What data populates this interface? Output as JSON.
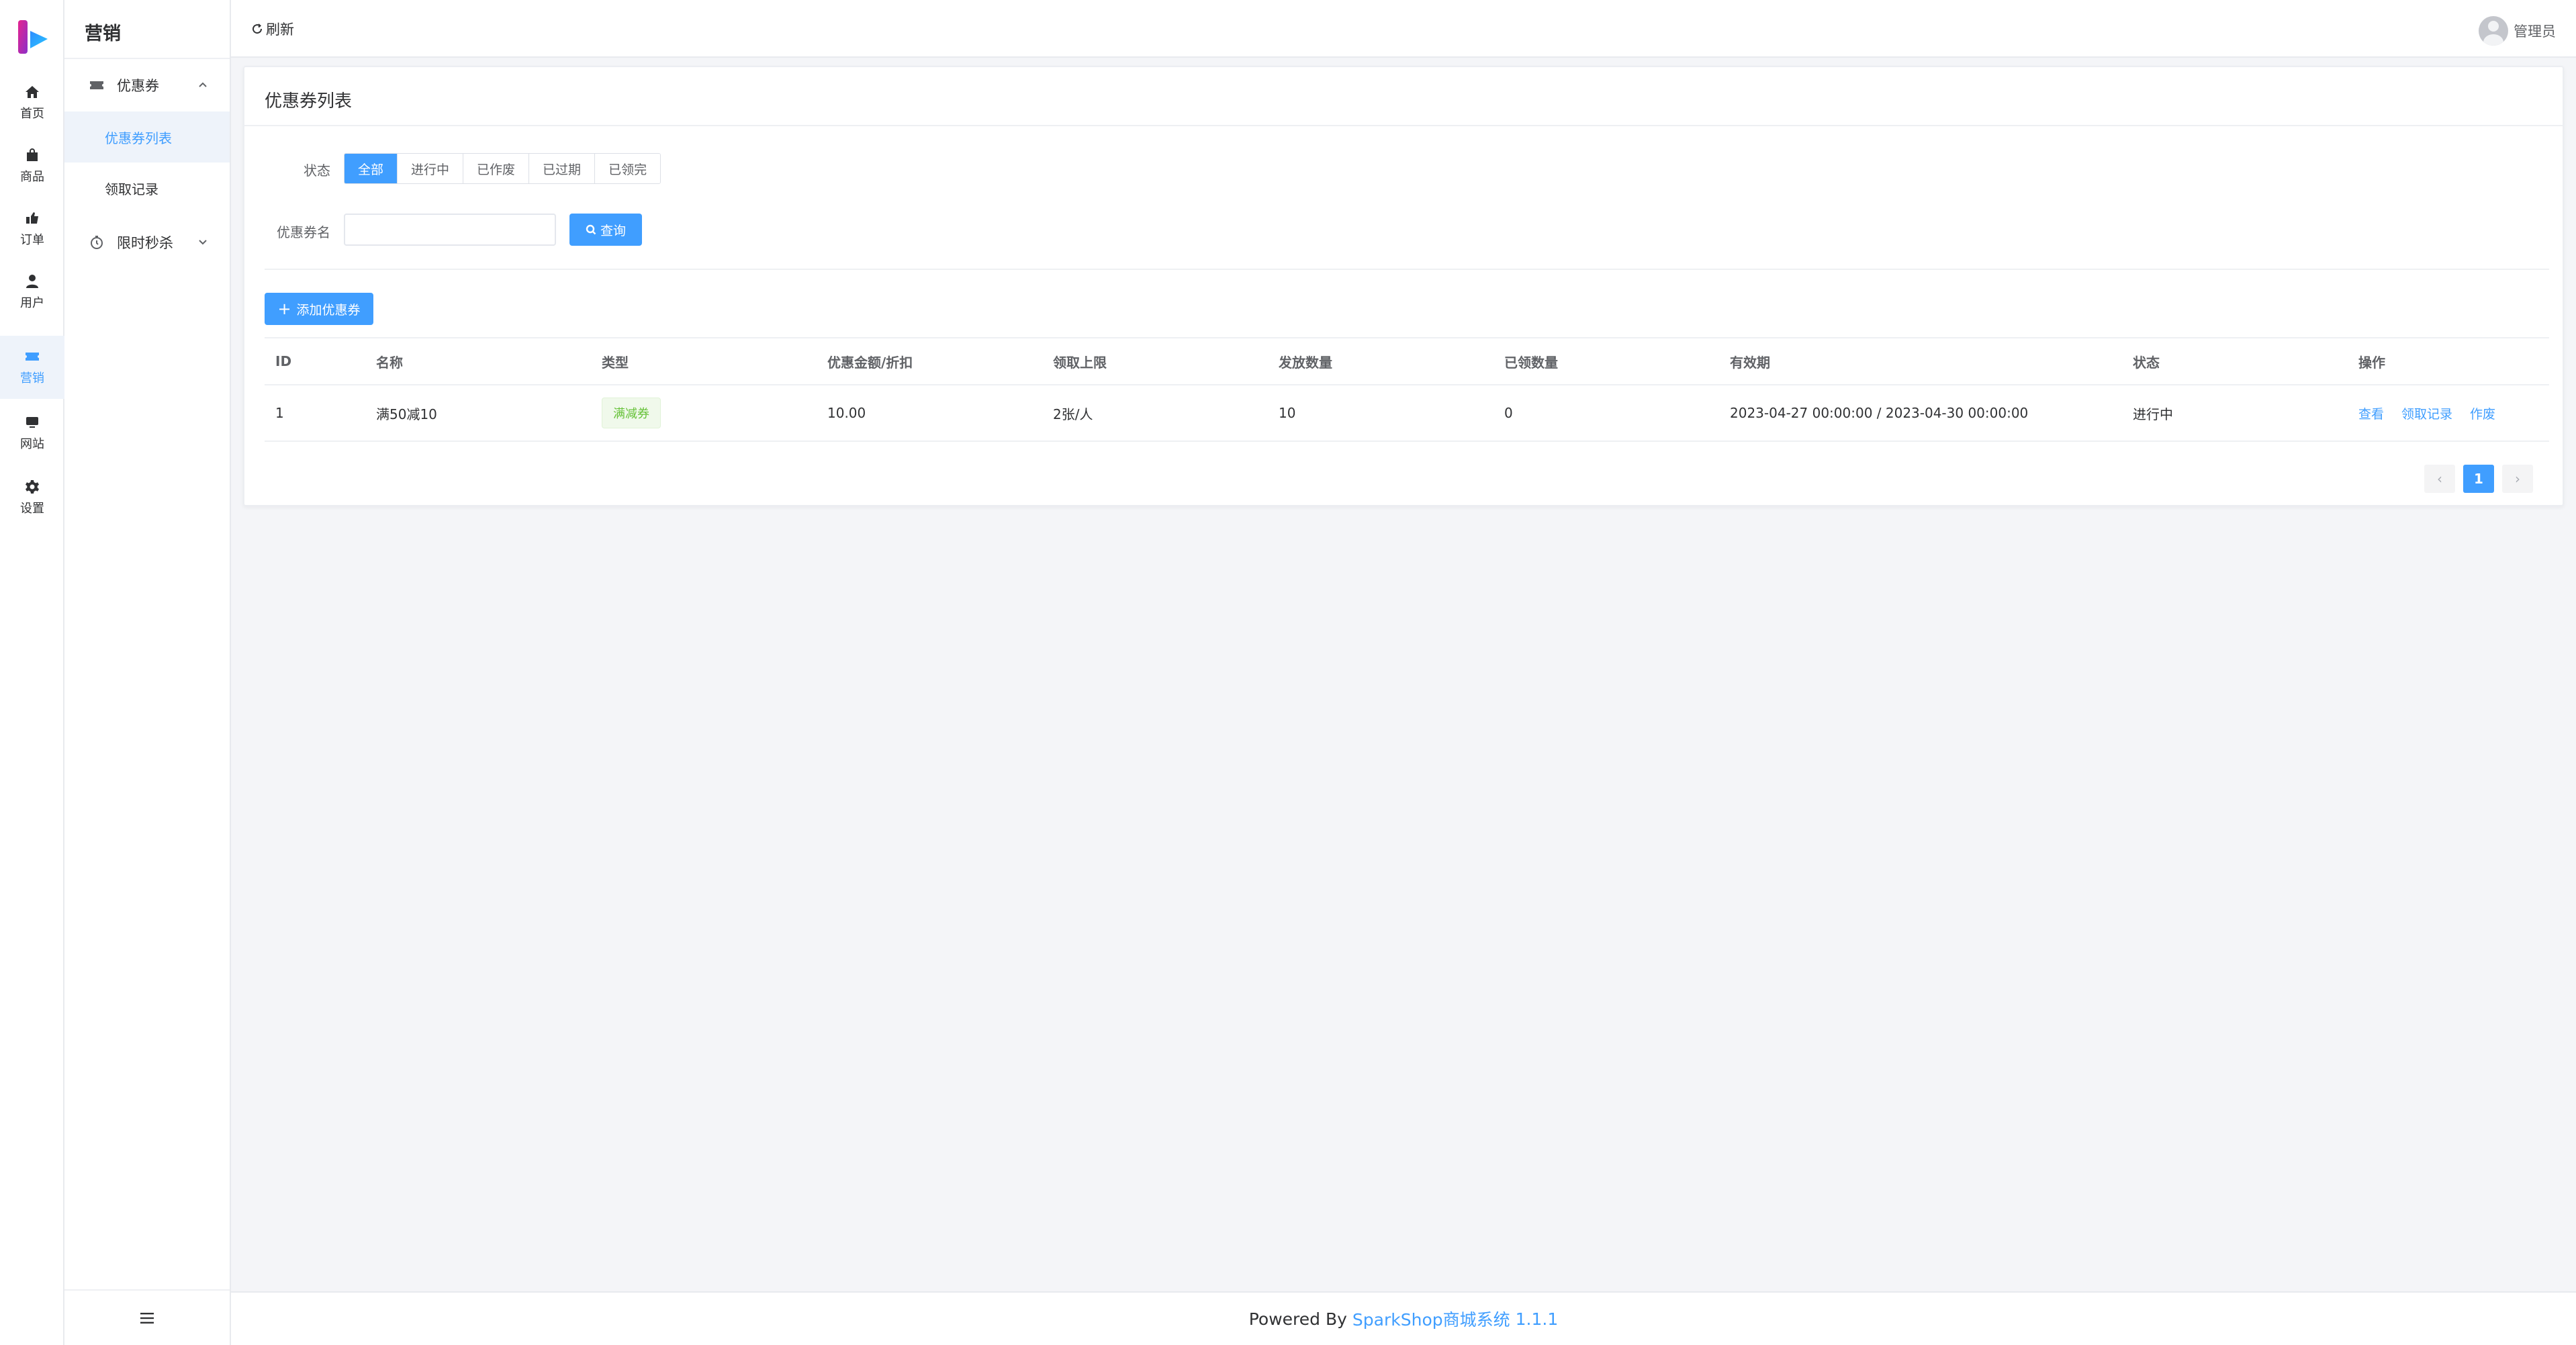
{
  "rail": {
    "items": [
      {
        "label": "首页",
        "icon": "home-icon"
      },
      {
        "label": "商品",
        "icon": "bag-icon"
      },
      {
        "label": "订单",
        "icon": "order-icon"
      },
      {
        "label": "用户",
        "icon": "user-icon"
      },
      {
        "label": "营销",
        "icon": "ticket-icon",
        "active": true
      },
      {
        "label": "网站",
        "icon": "monitor-icon"
      },
      {
        "label": "设置",
        "icon": "gear-icon"
      }
    ]
  },
  "sidebar": {
    "title": "营销",
    "groups": [
      {
        "label": "优惠券",
        "icon": "ticket-icon",
        "expanded": true,
        "children": [
          {
            "label": "优惠券列表",
            "active": true
          },
          {
            "label": "领取记录"
          }
        ]
      },
      {
        "label": "限时秒杀",
        "icon": "stopwatch-icon",
        "expanded": false
      }
    ]
  },
  "topbar": {
    "refresh_label": "刷新",
    "user_name": "管理员"
  },
  "card": {
    "title": "优惠券列表",
    "filter": {
      "status_label": "状态",
      "status_options": [
        "全部",
        "进行中",
        "已作废",
        "已过期",
        "已领完"
      ],
      "selected_status": "全部",
      "name_label": "优惠券名",
      "name_value": "",
      "query_label": "查询"
    },
    "add_label": "添加优惠券",
    "table": {
      "columns": [
        "ID",
        "名称",
        "类型",
        "优惠金额/折扣",
        "领取上限",
        "发放数量",
        "已领数量",
        "有效期",
        "状态",
        "操作"
      ],
      "rows": [
        {
          "id": "1",
          "name": "满50减10",
          "type": "满减券",
          "amount": "10.00",
          "limit": "2张/人",
          "issued": "10",
          "received": "0",
          "validity": "2023-04-27 00:00:00 / 2023-04-30 00:00:00",
          "status": "进行中",
          "actions": [
            "查看",
            "领取记录",
            "作废"
          ]
        }
      ]
    },
    "pagination": {
      "prev": "‹",
      "current": "1",
      "next": "›"
    }
  },
  "footer": {
    "prefix": "Powered By",
    "brand": "SparkShop商城系统",
    "version": "1.1.1"
  },
  "colors": {
    "accent": "#409eff",
    "tag_success": "#67c23a",
    "background": "#f4f5f8"
  }
}
